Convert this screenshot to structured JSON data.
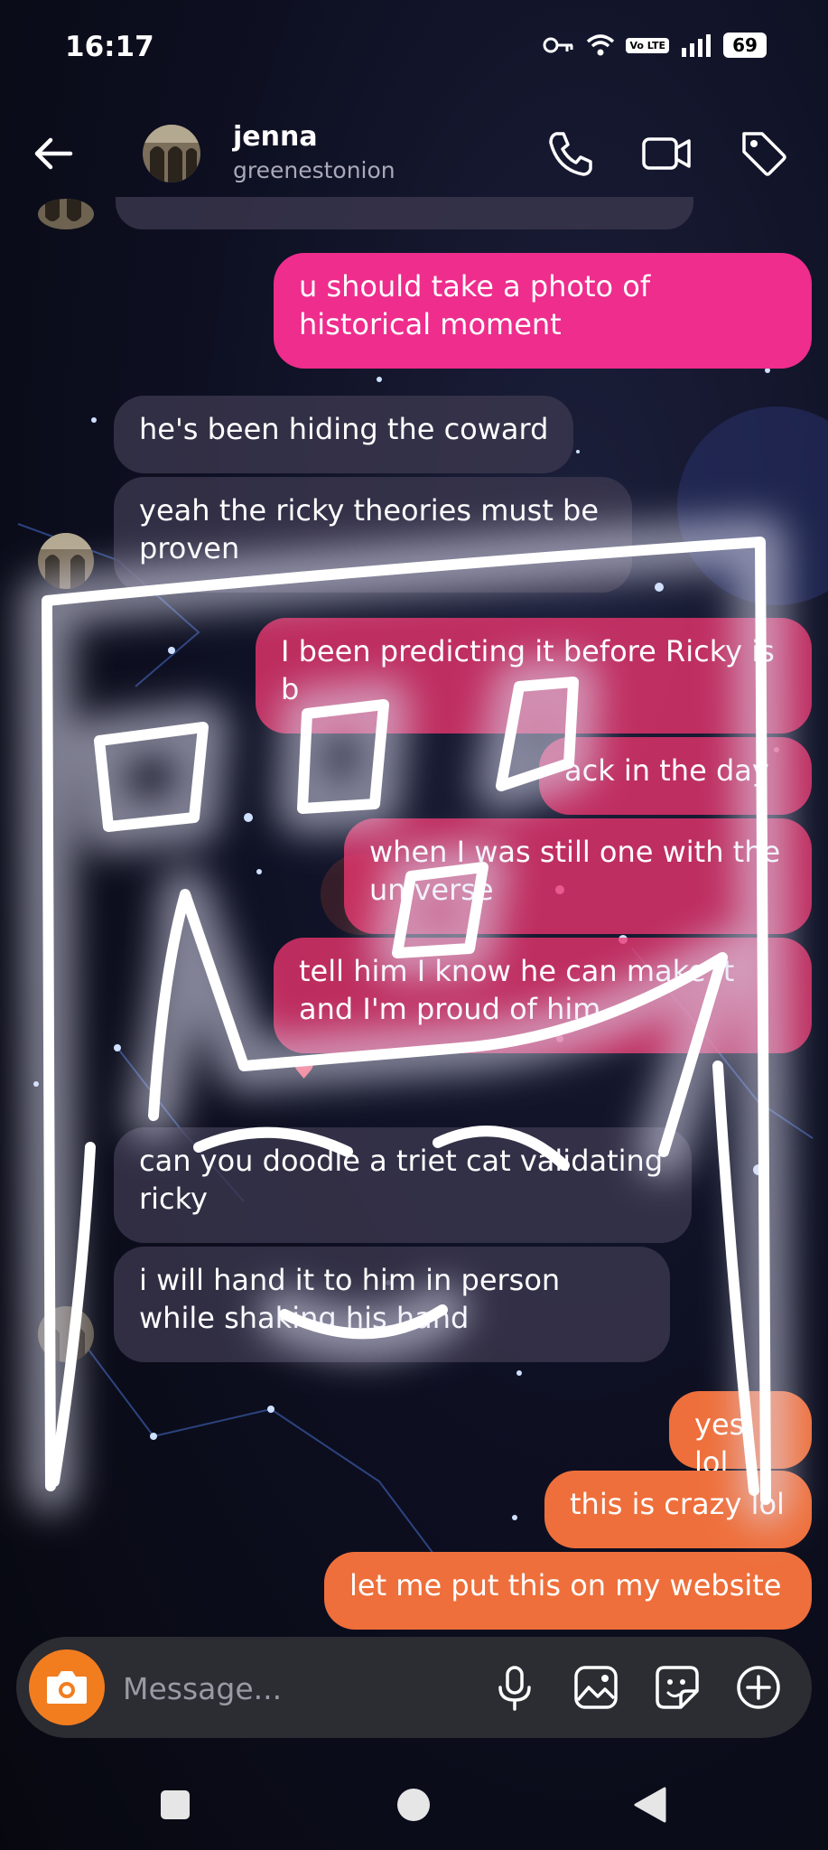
{
  "status_bar": {
    "time": "16:17",
    "volte": "Vo LTE",
    "battery": "69"
  },
  "header": {
    "name": "jenna",
    "username": "greenestonion"
  },
  "messages": {
    "m1": "u should take a photo of historical moment",
    "m2": "he's been hiding the coward",
    "m3": "yeah the ricky theories must be proven",
    "m4": "I been predicting it before Ricky is b",
    "m5": "ack in the day",
    "m6": "when I was still one with the universe",
    "m7": "tell him I know he can make it and I'm proud of him",
    "m8": "can you doodle a triet cat validating ricky",
    "m9": "i will hand it to him in person while shaking his hand",
    "m10": "yes lol",
    "m11": "this is crazy lol",
    "m12": "let me put this on my website"
  },
  "reaction": "♥",
  "composer": {
    "placeholder": "Message..."
  },
  "colors": {
    "sent_pink": "#ee2d8d",
    "sent_orange": "#ee6f3b",
    "received": "#3c3850",
    "camera": "#f27d1f"
  },
  "icons": [
    "back-arrow-icon",
    "phone-icon",
    "video-icon",
    "tag-icon",
    "camera-icon",
    "mic-icon",
    "gallery-icon",
    "sticker-icon",
    "plus-circle-icon",
    "square-nav-icon",
    "circle-nav-icon",
    "triangle-nav-icon"
  ]
}
